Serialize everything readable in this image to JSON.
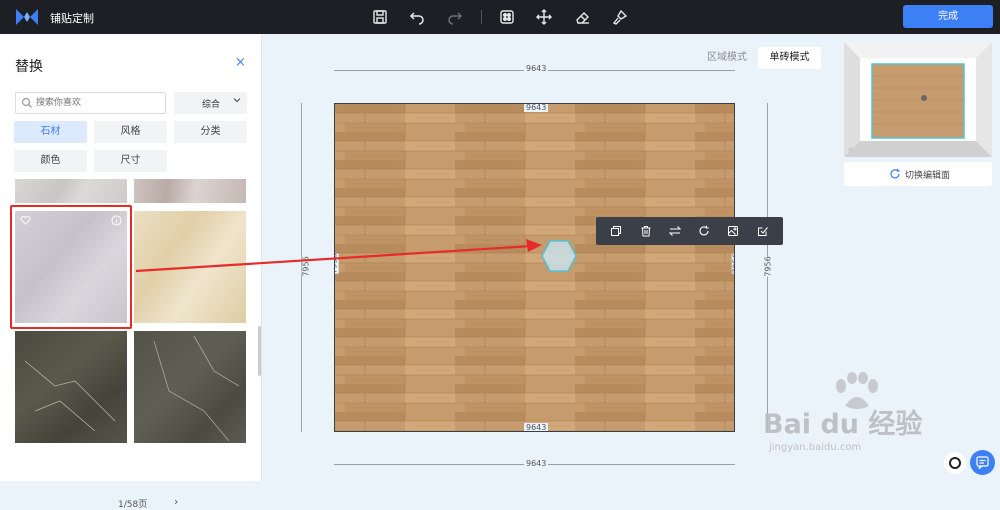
{
  "app": {
    "title": "铺贴定制",
    "done_label": "完成",
    "accent": "#3d7ff5"
  },
  "toolbar_icons": [
    "save-icon",
    "undo-icon",
    "redo-icon",
    "square-dot-icon",
    "move-icon",
    "eraser-icon",
    "brush-icon"
  ],
  "panel": {
    "title": "替换",
    "close": "×",
    "search_placeholder": "搜索你喜欢",
    "sort_label": "综合",
    "filters": [
      "石材",
      "风格",
      "分类",
      "颜色",
      "尺寸"
    ],
    "active_filter": "石材",
    "pager": "1/58页",
    "pager_next": "›"
  },
  "canvas": {
    "modes": [
      "区域模式",
      "单砖模式"
    ],
    "active_mode": "单砖模式",
    "dims": {
      "top_outer": "9643",
      "top_inner": "9643",
      "bottom_inner": "9643",
      "bottom_outer": "9643",
      "left_outer": "7956",
      "left_inner": "7956",
      "right_inner": "7956",
      "right_outer": "7956"
    },
    "float_toolbar_icons": [
      "copy-icon",
      "delete-icon",
      "swap-icon",
      "rotate-icon",
      "image-icon",
      "check-edit-icon"
    ],
    "minimap_button": "切换编辑面"
  },
  "watermark": {
    "brand": "Bai du 经验",
    "sub": "jingyan.baidu.com"
  }
}
